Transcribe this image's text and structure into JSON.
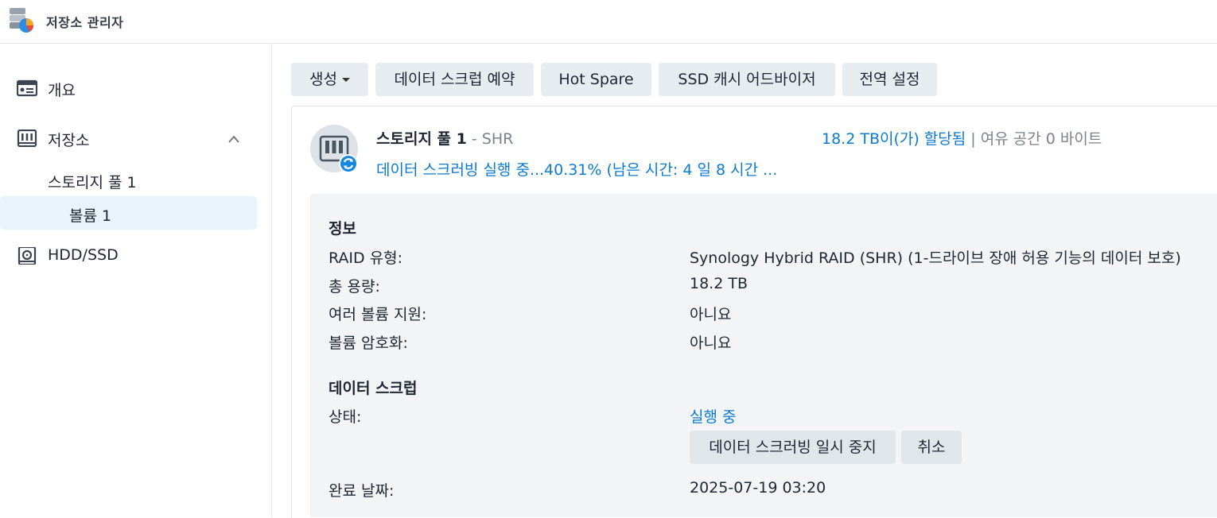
{
  "app": {
    "title": "저장소 관리자",
    "icon": "storage-manager-icon"
  },
  "sidebar": {
    "items": [
      {
        "label": "개요",
        "icon": "overview-card-icon"
      },
      {
        "label": "저장소",
        "icon": "storage-rack-icon",
        "expanded": true
      },
      {
        "label": "스토리지 풀 1"
      },
      {
        "label": "볼륨 1",
        "selected": true
      },
      {
        "label": "HDD/SSD",
        "icon": "hdd-icon"
      }
    ]
  },
  "toolbar": {
    "create_label": "생성",
    "scrub_schedule_label": "데이터 스크럽 예약",
    "hot_spare_label": "Hot Spare",
    "ssd_advisor_label": "SSD 캐시 어드바이저",
    "global_settings_label": "전역 설정"
  },
  "pool": {
    "name": "스토리지 풀 1",
    "separator": " - ",
    "type": "SHR",
    "allocated": "18.2 TB이(가) 할당됨",
    "divider": "|",
    "free": "여유 공간 0 바이트",
    "status_line": "데이터 스크러빙 실행 중...40.31% (남은 시간: 4 일 8 시간 ...",
    "scrub_progress_percent": 40.31
  },
  "info": {
    "title": "정보",
    "rows": [
      {
        "key": "RAID 유형:",
        "value": "Synology Hybrid RAID (SHR) (1-드라이브 장애 허용 기능의 데이터 보호)"
      },
      {
        "key": "총 용량:",
        "value": "18.2 TB"
      },
      {
        "key": "여러 볼륨 지원:",
        "value": "아니요"
      },
      {
        "key": "볼륨 암호화:",
        "value": "아니요"
      }
    ]
  },
  "scrub": {
    "title": "데이터 스크럽",
    "status_key": "상태:",
    "status_value": "실행 중",
    "pause_label": "데이터 스크러빙 일시 중지",
    "cancel_label": "취소",
    "completion_key": "완료 날짜:",
    "completion_value": "2025-07-19 03:20"
  },
  "colors": {
    "accent": "#0b7bd0",
    "selected_bg": "#e9f3fc",
    "button_bg": "#e7ecf1",
    "panel_bg": "#f2f4f6"
  }
}
